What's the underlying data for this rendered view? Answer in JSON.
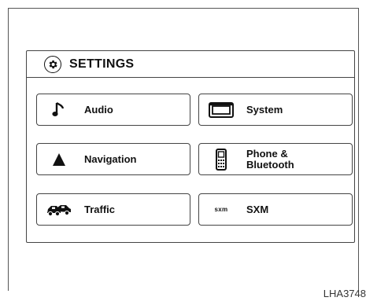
{
  "header": {
    "title": "SETTINGS",
    "icon": "gear-icon"
  },
  "tiles": [
    {
      "label": "Audio",
      "icon": "music-note-icon"
    },
    {
      "label": "System",
      "icon": "display-icon"
    },
    {
      "label": "Navigation",
      "icon": "navigation-arrow-icon"
    },
    {
      "label": "Phone &\nBluetooth",
      "icon": "phone-icon"
    },
    {
      "label": "Traffic",
      "icon": "traffic-cars-icon"
    },
    {
      "label": "SXM",
      "icon": "sxm-icon",
      "icon_text": "sxm"
    }
  ],
  "figure_code": "LHA3748"
}
